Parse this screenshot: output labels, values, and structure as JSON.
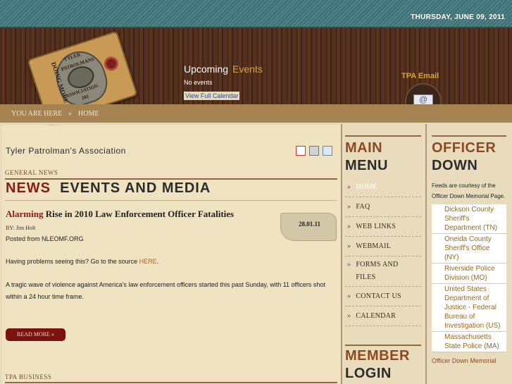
{
  "header": {
    "date": "THURSDAY, JUNE 09, 2011",
    "logo_text": {
      "line1": "TYLER",
      "line2": "PATROLMANS",
      "line3": "ASSOCIATION",
      "line4": "101",
      "side_text": "DOING MORE"
    },
    "events_title": "Upcoming",
    "events_title_accent": "Events",
    "events_empty": "No events",
    "calendar_link": "View Full Calendar",
    "tpa_email_label": "TPA Email"
  },
  "breadcrumb": {
    "prefix": "YOU ARE HERE",
    "separator": "»",
    "current": "HOME"
  },
  "main": {
    "site_title": "Tyler  Patrolman's  Association",
    "section_label": "GENERAL NEWS",
    "heading_accent": "NEWS",
    "heading_rest": "EVENTS  AND  MEDIA",
    "article": {
      "title_accent": "Alarming",
      "title_rest": "Rise in 2010 Law Enforcement Officer Fatalities",
      "byline": "BY: Jim Holt",
      "posted": "Posted from NLEOMF.ORG",
      "date": "28.01.11",
      "source_text": "Having problems seeing this?  Go to the source",
      "source_link": "HERE",
      "source_end": ".",
      "body": "A tragic wave of violence against America’s law enforcement officers started this past Sunday, with 11 officers shot within a 24 hour time frame.",
      "read_more": "READ MORE »"
    },
    "next_section_label": "TPA BUSINESS"
  },
  "menu": {
    "heading_line1": "MAIN",
    "heading_line2": "MENU",
    "items": [
      "HOME",
      "FAQ",
      "WEB LINKS",
      "WEBMAIL",
      "FORMS AND FILES",
      "CONTACT US",
      "CALENDAR"
    ],
    "member_line1": "MEMBER",
    "member_line2": "LOGIN"
  },
  "officer_down": {
    "heading_line1": "OFFICER",
    "heading_line2": "DOWN",
    "feed_note": "Feeds are courtesy of the Officer Down Memorial Page.",
    "items": [
      "Dickson County Sheriff's Department (TN)",
      "Oneida County Sheriff's Office (NY)",
      "Riverside Police Division (MO)",
      "United States Department of Justice - Federal Bureau of Investigation (US)",
      "Massachusetts State Police (MA)"
    ],
    "footer_link": "Officer Down Memorial"
  },
  "colors": {
    "accent_red": "#8b1a14",
    "accent_orange": "#d9a23a",
    "wood_brown": "#4a2a18",
    "teal": "#3e6e72"
  },
  "icons": [
    "pdf-icon",
    "print-icon",
    "email-icon"
  ]
}
